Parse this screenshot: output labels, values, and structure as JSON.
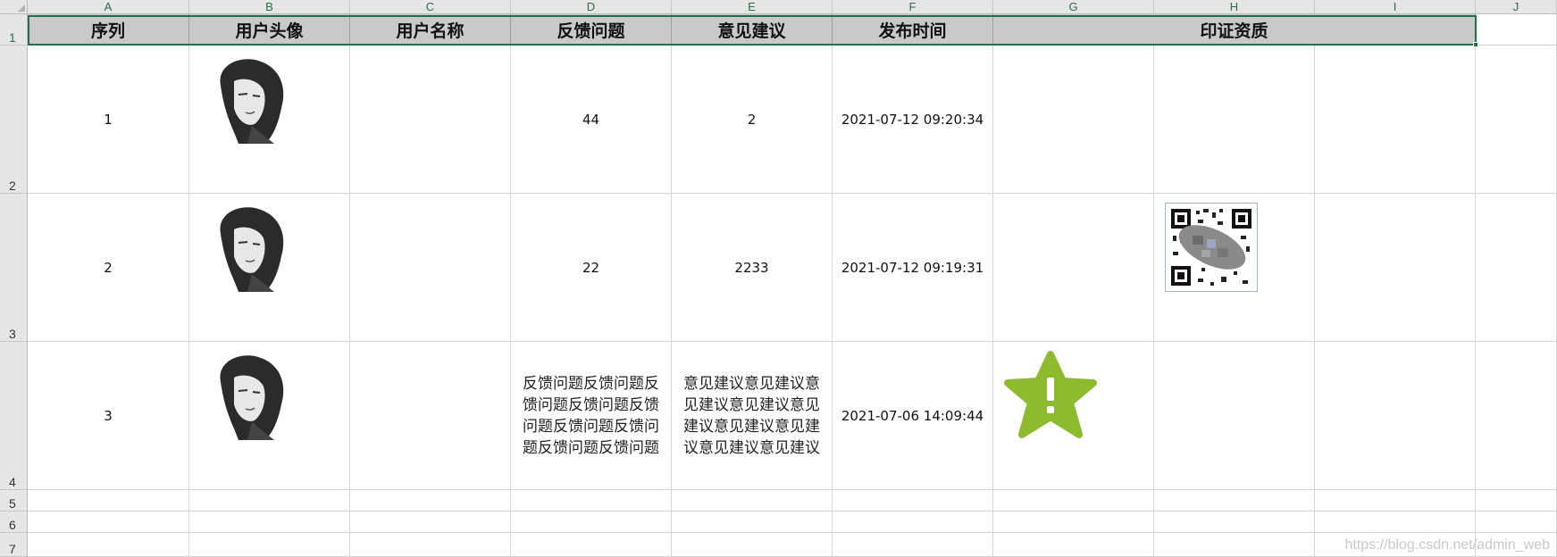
{
  "columns": [
    "A",
    "B",
    "C",
    "D",
    "E",
    "F",
    "G",
    "H",
    "I",
    "J"
  ],
  "rows": [
    "1",
    "2",
    "3",
    "4",
    "5",
    "6",
    "7"
  ],
  "headers": [
    "序列",
    "用户头像",
    "用户名称",
    "反馈问题",
    "意见建议",
    "发布时间",
    "印证资质"
  ],
  "data": [
    {
      "seq": "1",
      "name": "",
      "feedback": "44",
      "suggestion": "2",
      "time": "2021-07-12 09:20:34"
    },
    {
      "seq": "2",
      "name": "",
      "feedback": "22",
      "suggestion": "2233",
      "time": "2021-07-12 09:19:31"
    },
    {
      "seq": "3",
      "name": "",
      "feedback": "反馈问题反馈问题反馈问题反馈问题反馈问题反馈问题反馈问题反馈问题反馈问题",
      "suggestion": "意见建议意见建议意见建议意见建议意见建议意见建议意见建议意见建议意见建议",
      "time": "2021-07-06 14:09:44"
    }
  ],
  "icons": {
    "avatar": "person-portrait-icon",
    "qr": "qr-code-icon",
    "warning": "warning-star-icon"
  },
  "colors": {
    "selection": "#217346",
    "header_fill": "#c9c9c9",
    "warning": "#8dbb2e"
  },
  "watermark": "https://blog.csdn.net/admin_web"
}
